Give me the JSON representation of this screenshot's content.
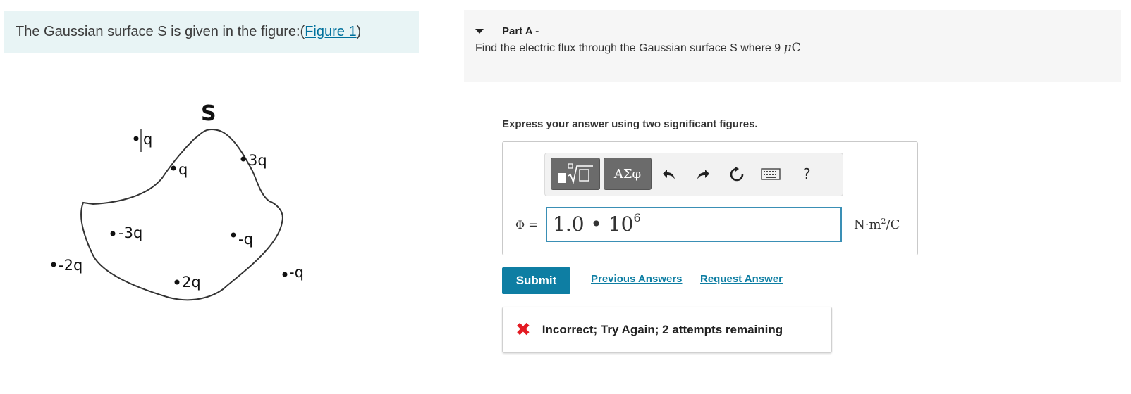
{
  "intro": {
    "text": "The Gaussian surface S is given in the figure:(",
    "link": "Figure 1",
    "close": ")"
  },
  "figure": {
    "surface_label": "S",
    "charges": [
      {
        "label": "q"
      },
      {
        "label": "q"
      },
      {
        "label": "3q"
      },
      {
        "label": "-3q"
      },
      {
        "label": "-q"
      },
      {
        "label": "-2q"
      },
      {
        "label": "2q"
      },
      {
        "label": "-q"
      }
    ]
  },
  "part": {
    "title": "Part A -",
    "question": "Find the electric flux through the Gaussian surface S where 9 ",
    "unit_mu": "μ",
    "unit_c": "C"
  },
  "instruction": "Express your answer using two significant figures.",
  "toolbar": {
    "templates_icon": "templates-sqrt-icon",
    "greek_label": "ΑΣφ",
    "undo_icon": "undo-icon",
    "redo_icon": "redo-icon",
    "reset_icon": "reset-icon",
    "keyboard_icon": "keyboard-icon",
    "help_label": "?"
  },
  "answer": {
    "variable_label": "Φ =",
    "mantissa": "1.0 • 10",
    "exponent": "6",
    "unit_base": "N·m",
    "unit_exp": "2",
    "unit_tail": "/C"
  },
  "actions": {
    "submit": "Submit",
    "previous_answers": "Previous Answers",
    "request_answer": "Request Answer"
  },
  "feedback": {
    "icon": "x-icon",
    "text": "Incorrect; Try Again; 2 attempts remaining",
    "color": "#e31b23"
  }
}
